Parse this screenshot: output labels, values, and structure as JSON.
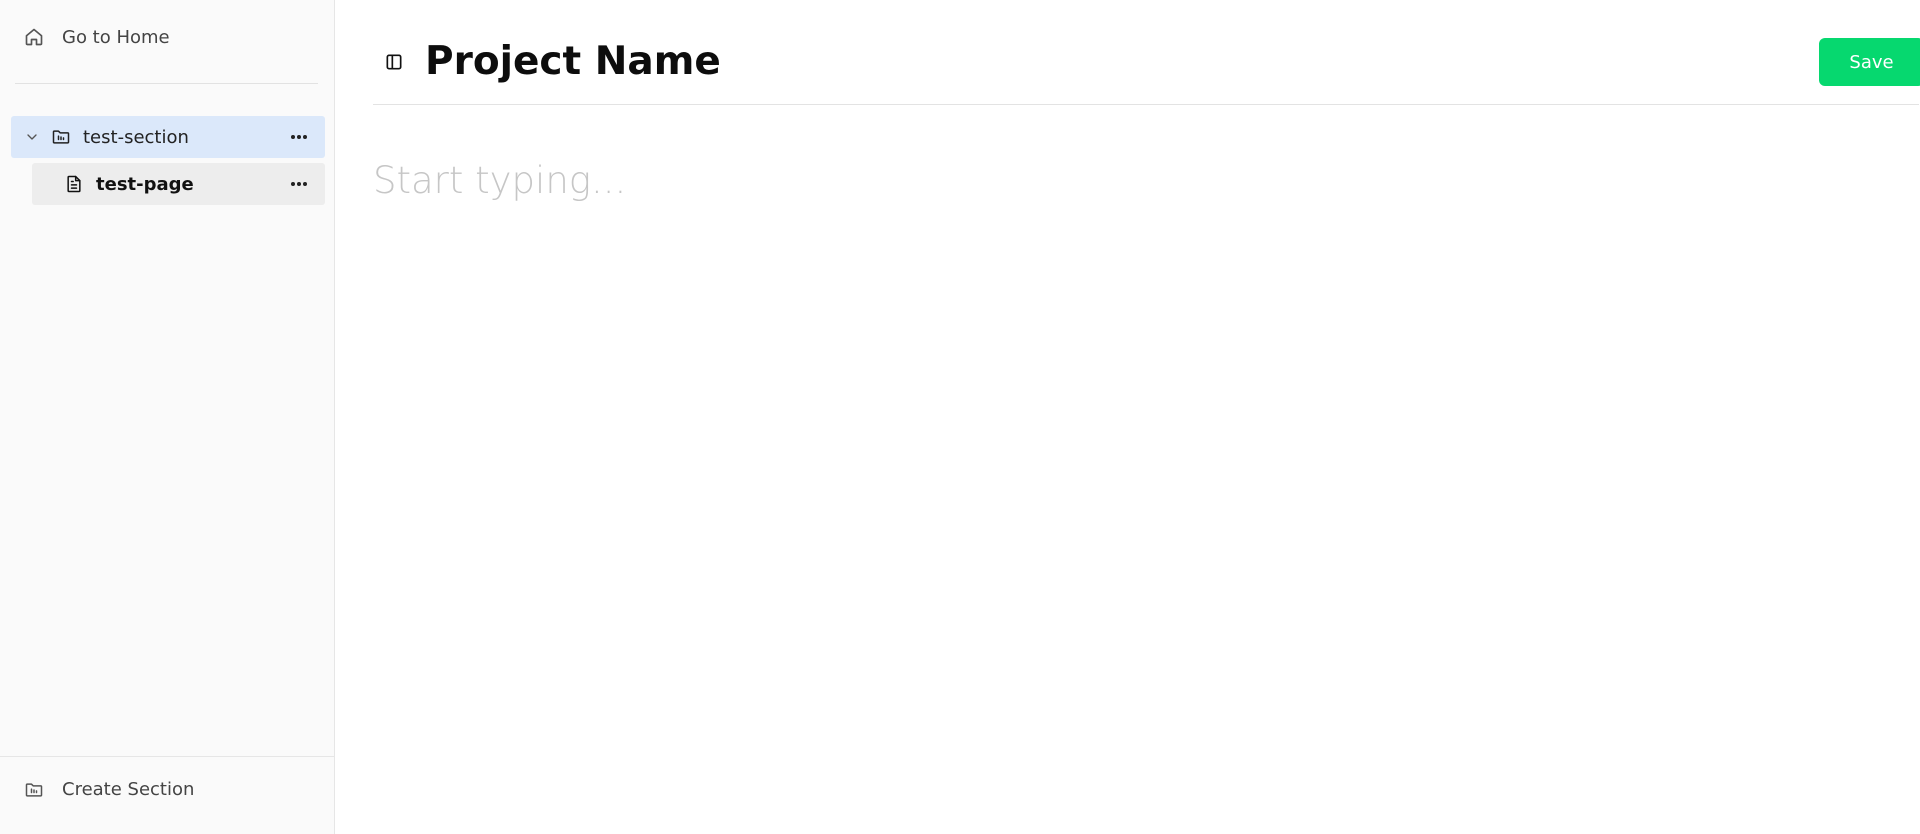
{
  "sidebar": {
    "home_label": "Go to Home",
    "tree": {
      "section": {
        "label": "test-section",
        "expanded": true
      },
      "page": {
        "label": "test-page"
      }
    },
    "footer": {
      "create_section_label": "Create Section"
    }
  },
  "header": {
    "title": "Project Name",
    "save_label": "Save"
  },
  "editor": {
    "placeholder": "Start typing..."
  },
  "colors": {
    "accent": "#06d86f",
    "selected_section_bg": "#dbe8fa",
    "selected_page_bg": "#ededed",
    "sidebar_bg": "#fafafa"
  },
  "icons": {
    "home": "home-icon",
    "chevron": "chevron-down-icon",
    "folder": "folder-icon",
    "document": "document-icon",
    "more": "more-horizontal-icon",
    "sidebar_toggle": "sidebar-toggle-icon"
  }
}
